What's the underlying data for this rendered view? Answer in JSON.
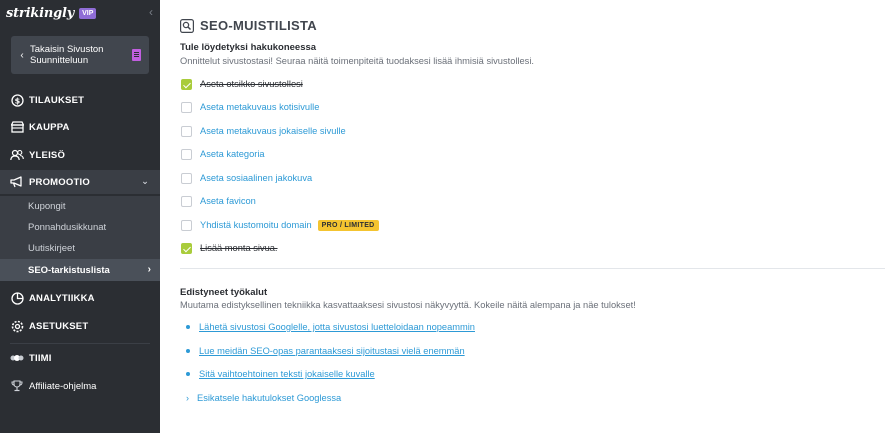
{
  "sidebar": {
    "brand": "strikingly",
    "vip_badge": "VIP",
    "back_button": "Takaisin Sivuston Suunnitteluun",
    "items": [
      {
        "label": "TILAUKSET",
        "icon": "dollar-icon"
      },
      {
        "label": "KAUPPA",
        "icon": "store-icon"
      },
      {
        "label": "YLEISÖ",
        "icon": "audience-icon"
      },
      {
        "label": "PROMOOTIO",
        "icon": "megaphone-icon"
      },
      {
        "label": "ANALYTIIKKA",
        "icon": "chart-icon"
      },
      {
        "label": "ASETUKSET",
        "icon": "gear-icon"
      },
      {
        "label": "TIIMI",
        "icon": "team-icon"
      },
      {
        "label": "Affiliate-ohjelma",
        "icon": "trophy-icon"
      }
    ],
    "promo_sub": [
      "Kupongit",
      "Ponnahdusikkunat",
      "Uutiskirjeet",
      "SEO-tarkistuslista"
    ]
  },
  "main": {
    "title": "SEO-MUISTILISTA",
    "section1_heading": "Tule löydetyksi hakukoneessa",
    "section1_lead": "Onnittelut sivustostasi! Seuraa näitä toimenpiteitä tuodaksesi lisää ihmisiä sivustollesi.",
    "checklist": [
      {
        "label": "Aseta otsikko sivustollesi",
        "done": true
      },
      {
        "label": "Aseta metakuvaus kotisivulle",
        "done": false
      },
      {
        "label": "Aseta metakuvaus jokaiselle sivulle",
        "done": false
      },
      {
        "label": "Aseta kategoria",
        "done": false
      },
      {
        "label": "Aseta sosiaalinen jakokuva",
        "done": false
      },
      {
        "label": "Aseta favicon",
        "done": false
      },
      {
        "label": "Yhdistä kustomoitu domain",
        "done": false,
        "badge": "PRO / LIMITED"
      },
      {
        "label": "Lisää monta sivua.",
        "done": true
      }
    ],
    "section2_heading": "Edistyneet työkalut",
    "section2_lead": "Muutama edistyksellinen tekniikka kasvattaaksesi sivustosi näkyvyyttä. Kokeile näitä alempana ja näe tulokset!",
    "links": [
      "Lähetä sivustosi Googlelle, jotta sivustosi luetteloidaan nopeammin",
      "Lue meidän SEO-opas parantaaksesi sijoitustasi vielä enemmän",
      "Sitä vaihtoehtoinen teksti jokaiselle kuvalle",
      "Esikatsele hakutulokset Googlessa"
    ]
  },
  "colors": {
    "sidebar_bg": "#2b2e33",
    "accent_link": "#2d9ad6",
    "check_green": "#a9cc3b",
    "badge_yellow": "#f4c430",
    "vip_purple": "#8f6dd6"
  }
}
